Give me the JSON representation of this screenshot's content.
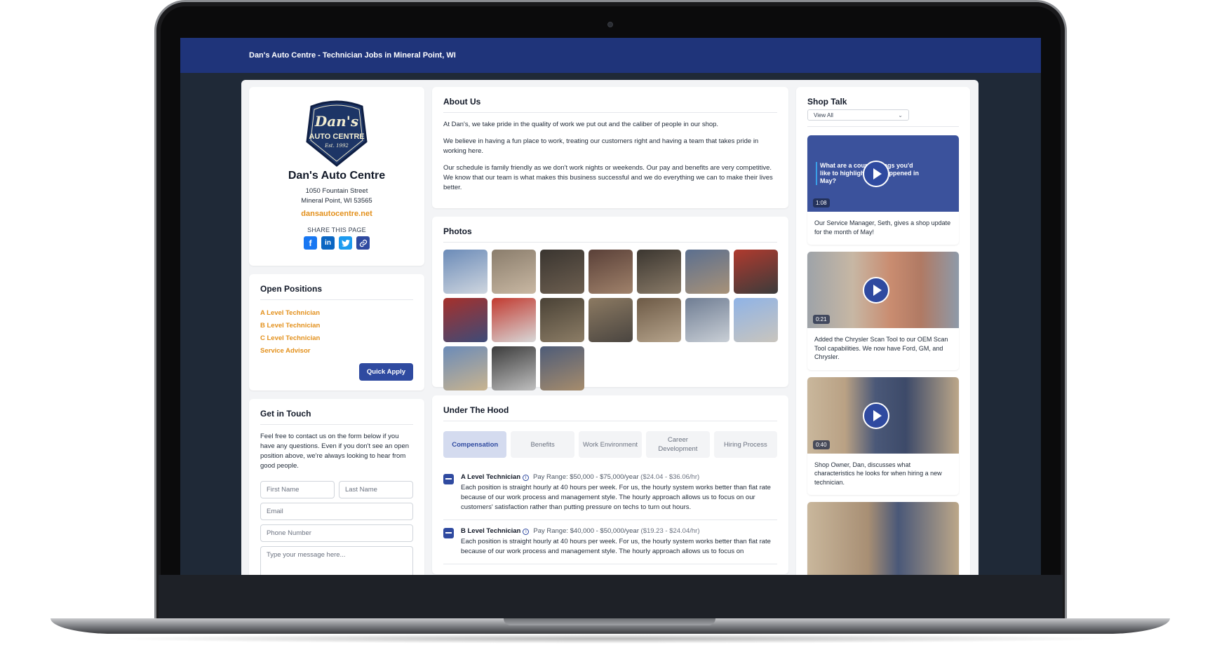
{
  "header": {
    "title": "Dan's Auto Centre - Technician Jobs in Mineral Point, WI"
  },
  "profile": {
    "logo": {
      "script": "Dan's",
      "name": "AUTO CENTRE",
      "est": "Est. 1992"
    },
    "company_name": "Dan's Auto Centre",
    "address_line1": "1050 Fountain Street",
    "address_line2": "Mineral Point, WI 53565",
    "website": "dansautocentre.net",
    "share_label": "SHARE THIS PAGE",
    "share_icons": [
      "facebook-icon",
      "linkedin-icon",
      "twitter-icon",
      "link-icon"
    ],
    "share_colors": {
      "facebook": "#1877f2",
      "linkedin": "#0a66c2",
      "twitter": "#1d9bf0",
      "link": "#2f4aa0"
    }
  },
  "open_positions": {
    "title": "Open Positions",
    "items": [
      "A Level Technician",
      "B Level Technician",
      "C Level Technician",
      "Service Advisor"
    ],
    "quick_apply_label": "Quick Apply"
  },
  "get_in_touch": {
    "title": "Get in Touch",
    "description": "Feel free to contact us on the form below if you have any questions. Even if you don't see an open position above, we're always looking to hear from good people.",
    "first_name_placeholder": "First Name",
    "last_name_placeholder": "Last Name",
    "email_placeholder": "Email",
    "phone_placeholder": "Phone Number",
    "message_placeholder": "Type your message here..."
  },
  "about": {
    "title": "About Us",
    "paragraphs": [
      "At Dan's, we take pride in the quality of work we put out and the caliber of people in our shop.",
      "We believe in having a fun place to work, treating our customers right and having a team that takes pride in working here.",
      "Our schedule is family friendly as we don't work nights or weekends. Our pay and benefits are very competitive. We know that our team is what makes this business successful and we do everything we can to make their lives better."
    ]
  },
  "photos": {
    "title": "Photos",
    "count": 17
  },
  "under_the_hood": {
    "title": "Under The Hood",
    "tabs": [
      "Compensation",
      "Benefits",
      "Work Environment",
      "Career Development",
      "Hiring Process"
    ],
    "active_tab": "Compensation",
    "items": [
      {
        "title": "A Level Technician",
        "pay_range": "Pay Range: $50,000 - $75,000/year",
        "hourly": "($24.04 - $36.06/hr)",
        "description": "Each position is straight hourly at 40 hours per week. For us, the hourly system works better than flat rate because of our work process and management style. The hourly approach allows us to focus on our customers' satisfaction rather than putting pressure on techs to turn out hours."
      },
      {
        "title": "B Level Technician",
        "pay_range": "Pay Range: $40,000 - $50,000/year",
        "hourly": "($19.23 - $24.04/hr)",
        "description": "Each position is straight hourly at 40 hours per week. For us, the hourly system works better than flat rate because of our work process and management style. The hourly approach allows us to focus on"
      }
    ]
  },
  "shop_talk": {
    "title": "Shop Talk",
    "filter_value": "View All",
    "videos": [
      {
        "duration": "1:08",
        "overlay": "What are a couple things you'd like to highlight that happened in May?",
        "caption": "Our Service Manager, Seth, gives a shop update for the month of May!"
      },
      {
        "duration": "0:21",
        "caption": "Added the Chrysler Scan Tool to our OEM Scan Tool capabilities. We now have Ford, GM, and Chrysler."
      },
      {
        "duration": "0:40",
        "caption": "Shop Owner, Dan, discusses what characteristics he looks for when hiring a new technician."
      }
    ]
  },
  "colors": {
    "brand": "#1f347a",
    "accent": "#e3901b",
    "button": "#2f4aa0"
  }
}
